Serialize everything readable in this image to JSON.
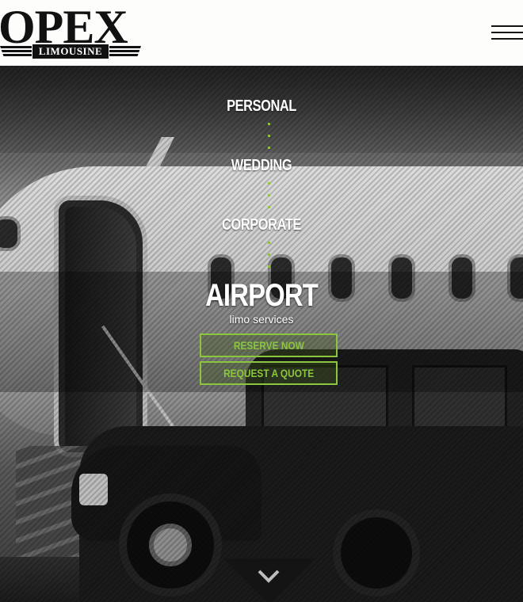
{
  "brand": {
    "name": "OPEX",
    "subtitle": "LIMOUSINE"
  },
  "header": {
    "menu_icon": "hamburger-menu-icon"
  },
  "services": [
    {
      "label": "PERSONAL"
    },
    {
      "label": "WEDDING"
    },
    {
      "label": "CORPORATE"
    }
  ],
  "hero": {
    "active_service": "AIRPORT",
    "tagline": "limo services",
    "reserve_label": "RESERVE NOW",
    "quote_label": "REQUEST A QUOTE",
    "scroll_icon": "chevron-down-icon"
  },
  "colors": {
    "accent": "#8cc63f",
    "header_bg": "#fdfdfb",
    "logo": "#111111"
  }
}
